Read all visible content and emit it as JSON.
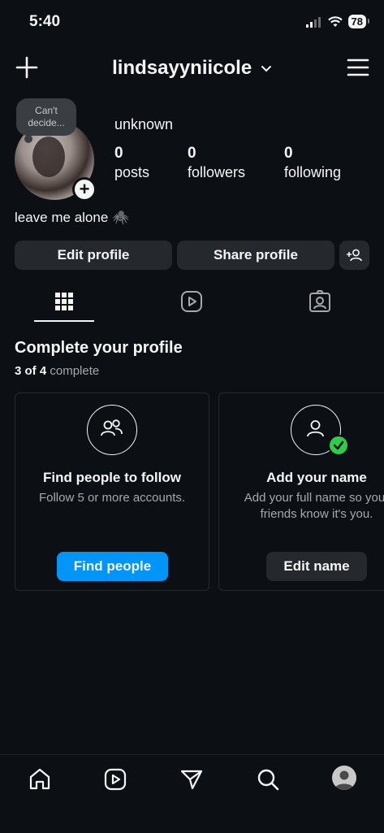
{
  "status_bar": {
    "time": "5:40",
    "battery": "78"
  },
  "header": {
    "username": "lindsayyniicole"
  },
  "profile": {
    "note": "Can't decide...",
    "display_name": "unknown",
    "stats": [
      {
        "value": "0",
        "label": "posts"
      },
      {
        "value": "0",
        "label": "followers"
      },
      {
        "value": "0",
        "label": "following"
      }
    ],
    "bio": "leave me alone 🕷️",
    "buttons": {
      "edit": "Edit profile",
      "share": "Share profile"
    }
  },
  "complete_profile": {
    "title": "Complete your profile",
    "progress_count": "3 of 4",
    "progress_label": "complete",
    "cards": [
      {
        "title": "Find people to follow",
        "desc": "Follow 5 or more accounts.",
        "button": "Find people"
      },
      {
        "title": "Add your name",
        "desc": "Add your full name so your friends know it's you.",
        "button": "Edit name"
      }
    ]
  },
  "colors": {
    "background": "#0c1014",
    "button": "#25292e",
    "primary": "#0095f6",
    "check": "#2ecc4a"
  }
}
